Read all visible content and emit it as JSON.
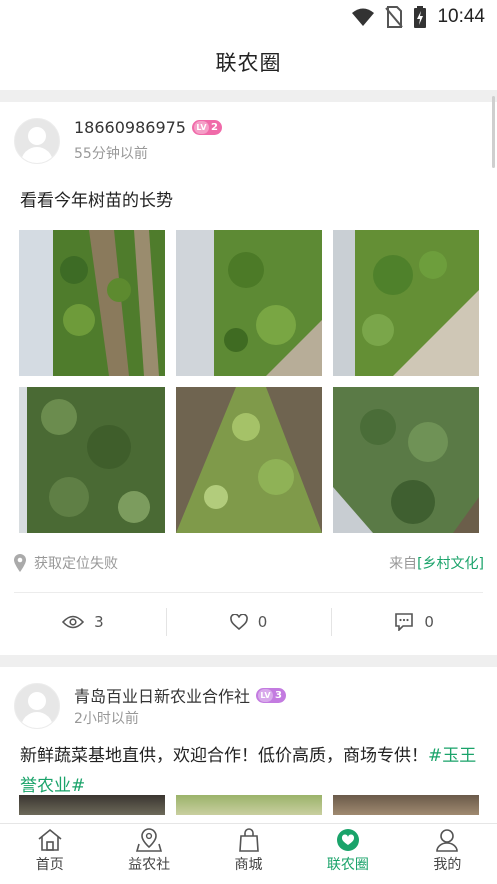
{
  "status_bar": {
    "time": "10:44",
    "icons": [
      "wifi-icon",
      "no-sim-icon",
      "battery-charging-icon"
    ]
  },
  "header": {
    "title": "联农圈"
  },
  "posts": [
    {
      "user": "18660986975",
      "level": "2",
      "level_prefix": "LV",
      "level_color": "#f06aa9",
      "time": "55分钟以前",
      "text": "看看今年树苗的长势",
      "photos": 6,
      "location": "获取定位失败",
      "from_prefix": "来自",
      "from_source": "[乡村文化]",
      "views": "3",
      "likes": "0",
      "comments": "0"
    },
    {
      "user": "青岛百业日新农业合作社",
      "level": "3",
      "level_prefix": "LV",
      "level_color": "#c37be0",
      "time": "2小时以前",
      "text": "新鲜蔬菜基地直供，欢迎合作！低价高质，商场专供！",
      "hashtag": "#玉王誉农业#"
    }
  ],
  "tabbar": {
    "items": [
      {
        "label": "首页",
        "icon": "home-icon",
        "active": false
      },
      {
        "label": "益农社",
        "icon": "map-pin-icon",
        "active": false
      },
      {
        "label": "商城",
        "icon": "shopping-bag-icon",
        "active": false
      },
      {
        "label": "联农圈",
        "icon": "heart-chat-icon",
        "active": true
      },
      {
        "label": "我的",
        "icon": "user-icon",
        "active": false
      }
    ]
  },
  "colors": {
    "accent": "#1aa36a",
    "muted": "#999999"
  }
}
